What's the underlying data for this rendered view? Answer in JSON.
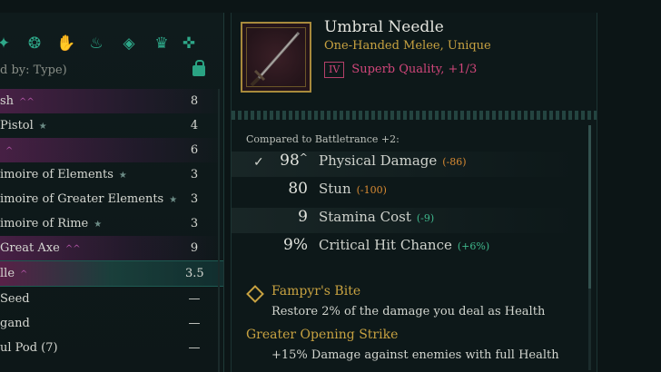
{
  "list": {
    "sort_label": "d by: Type)",
    "filter_icons": [
      "sword-icon",
      "rings-icon",
      "gloves-icon",
      "lamp-icon",
      "gem-icon",
      "crown-icon",
      "dpad-icon"
    ],
    "items": [
      {
        "name": "sh",
        "mark": "^^",
        "mark_color": "pink",
        "qty": "8",
        "style": "pinkbg"
      },
      {
        "name": "Pistol",
        "mark": "★",
        "mark_color": "teal",
        "qty": "4",
        "style": ""
      },
      {
        "name": "",
        "mark": "^",
        "mark_color": "pink",
        "qty": "6",
        "style": "pinkbg"
      },
      {
        "name": "imoire of Elements",
        "mark": "★",
        "mark_color": "teal",
        "qty": "3",
        "style": ""
      },
      {
        "name": "imoire of Greater Elements",
        "mark": "★",
        "mark_color": "teal",
        "qty": "3",
        "style": ""
      },
      {
        "name": "imoire of Rime",
        "mark": "★",
        "mark_color": "teal",
        "qty": "3",
        "style": ""
      },
      {
        "name": "Great Axe",
        "mark": "^^",
        "mark_color": "pink",
        "qty": "9",
        "style": "pinkbg"
      },
      {
        "name": "lle",
        "mark": "^",
        "mark_color": "pink",
        "qty": "3.5",
        "style": "sel"
      },
      {
        "name": "Seed",
        "mark": "",
        "mark_color": "",
        "qty": "—",
        "style": ""
      },
      {
        "name": "gand",
        "mark": "",
        "mark_color": "",
        "qty": "—",
        "style": ""
      },
      {
        "name": "ul Pod (7)",
        "mark": "",
        "mark_color": "",
        "qty": "—",
        "style": ""
      },
      {
        "name": "",
        "mark": "",
        "mark_color": "",
        "qty": "—",
        "style": ""
      }
    ]
  },
  "item": {
    "title": "Umbral Needle",
    "type": "One-Handed Melee, Unique",
    "quality_badge": "IV",
    "quality_text": "Superb Quality, +1/3",
    "compare_label": "Compared to Battletrance +2:",
    "stats": [
      {
        "value": "98",
        "label": "Physical Damage",
        "delta": "(-86)",
        "delta_kind": "neg",
        "checked": true,
        "arrow": "^"
      },
      {
        "value": "80",
        "label": "Stun",
        "delta": "(-100)",
        "delta_kind": "neg",
        "checked": false,
        "arrow": ""
      },
      {
        "value": "9",
        "label": "Stamina Cost",
        "delta": "(-9)",
        "delta_kind": "pos",
        "checked": false,
        "arrow": ""
      },
      {
        "value": "9%",
        "label": "Critical Hit Chance",
        "delta": "(+6%)",
        "delta_kind": "pos",
        "checked": false,
        "arrow": ""
      }
    ],
    "perk1_title": "Fampyr's Bite",
    "perk1_desc": "Restore 2% of the damage you deal as Health",
    "perk2_title": "Greater Opening Strike",
    "perk2_desc": "+15% Damage against enemies with full Health"
  }
}
